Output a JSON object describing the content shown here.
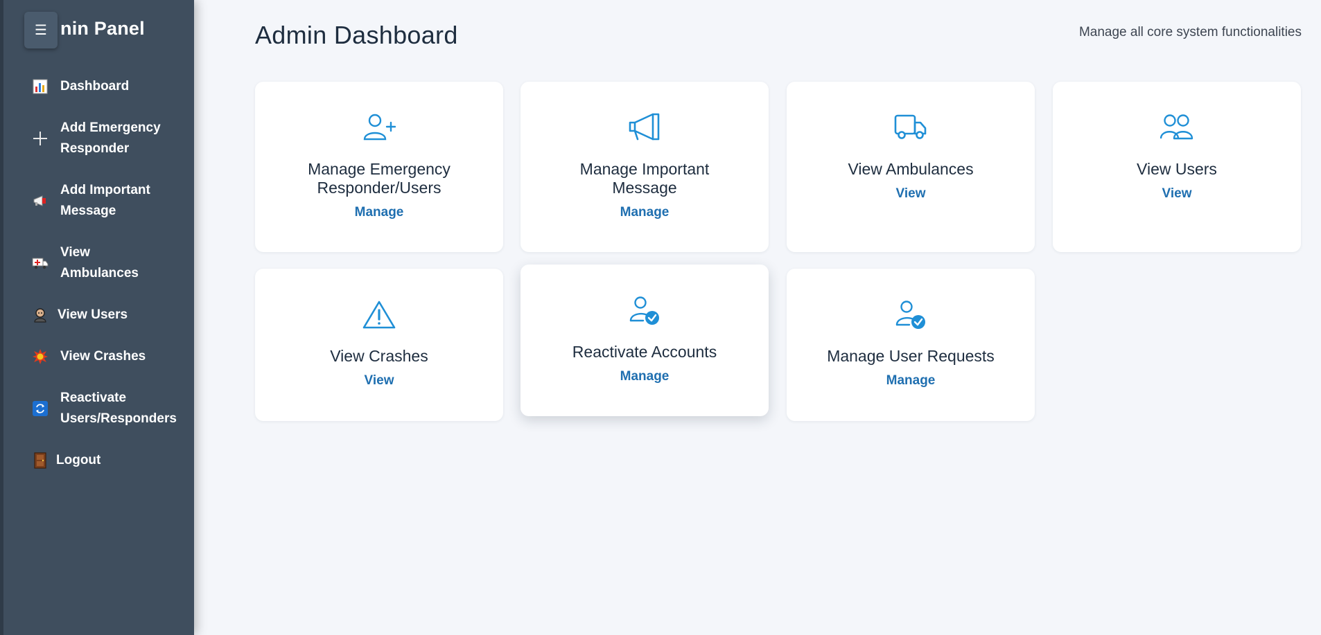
{
  "sidebar": {
    "title": "nin Panel",
    "toggle_icon": "hamburger-icon",
    "items": [
      {
        "label": "Dashboard",
        "icon": "bar-chart-icon"
      },
      {
        "label": "Add Emergency\nResponder",
        "icon": "plus-icon"
      },
      {
        "label": "Add Important\nMessage",
        "icon": "megaphone-icon"
      },
      {
        "label": "View\nAmbulances",
        "icon": "ambulance-icon"
      },
      {
        "label": "View Users",
        "icon": "user-icon"
      },
      {
        "label": "View Crashes",
        "icon": "collision-icon"
      },
      {
        "label": "Reactivate\nUsers/Responders",
        "icon": "refresh-icon"
      },
      {
        "label": "Logout",
        "icon": "door-icon"
      }
    ]
  },
  "header": {
    "title": "Admin Dashboard",
    "subtitle": "Manage all core system functionalities"
  },
  "cards": [
    {
      "title": "Manage Emergency Responder/Users",
      "action": "Manage",
      "icon": "user-plus-icon"
    },
    {
      "title": "Manage Important Message",
      "action": "Manage",
      "icon": "megaphone-icon"
    },
    {
      "title": "View Ambulances",
      "action": "View",
      "icon": "truck-icon"
    },
    {
      "title": "View Users",
      "action": "View",
      "icon": "users-icon"
    },
    {
      "title": "View Crashes",
      "action": "View",
      "icon": "warning-icon"
    },
    {
      "title": "Reactivate Accounts",
      "action": "Manage",
      "icon": "user-check-icon"
    },
    {
      "title": "Manage User Requests",
      "action": "Manage",
      "icon": "user-check-icon"
    }
  ],
  "colors": {
    "sidebar_bg": "#3f4e5e",
    "accent": "#1f8fd6",
    "link": "#1f6fb0",
    "page_bg": "#f4f6fa"
  }
}
